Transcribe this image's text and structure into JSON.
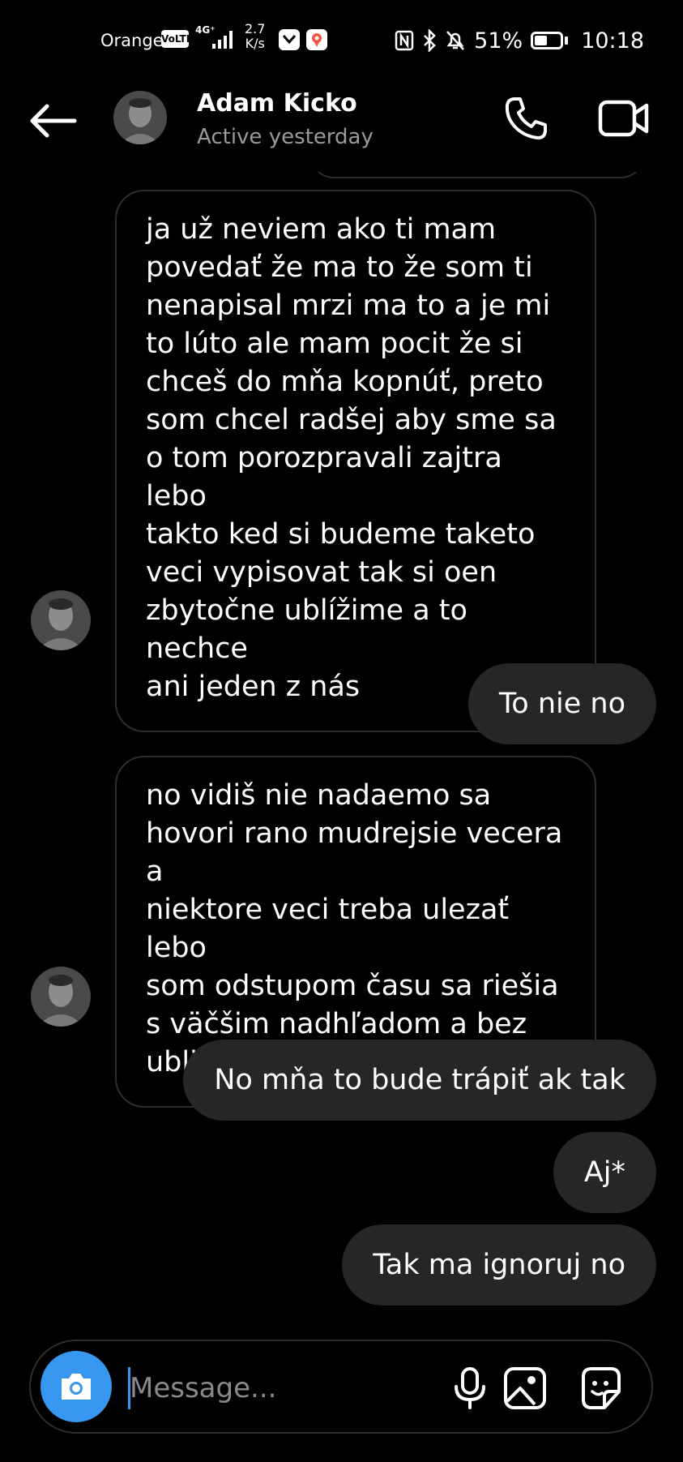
{
  "status_bar": {
    "carrier": "Orange",
    "volte": "VoLTE",
    "network": "4G⁺",
    "speed_value": "2.7",
    "speed_unit": "K/s",
    "battery": "51%",
    "time": "10:18"
  },
  "header": {
    "contact_name": "Adam Kicko",
    "contact_status": "Active yesterday"
  },
  "messages": [
    {
      "direction": "incoming",
      "text": "ja už neviem ako ti mam\npovedať že ma to že som ti\nnenapisal mrzi  ma to a je mi\nto lúto ale mam pocit že si\nchceš do mňa kopnúť, preto\nsom chcel radšej aby sme sa\no tom porozpravali zajtra lebo\ntakto ked si budeme taketo\nveci vypisovat tak si oen\nzbytočne ublížime a to nechce\nani jeden z nás"
    },
    {
      "direction": "outgoing",
      "text": "To nie no"
    },
    {
      "direction": "incoming",
      "text": "no vidiš nie nadaemo sa\nhovori rano mudrejsie vecera a\nniektore veci treba ulezať lebo\nsom odstupom času sa riešia\ns väčšim nadhľadom a bez\nubližovania"
    },
    {
      "direction": "outgoing",
      "text": "No mňa to bude trápiť ak tak"
    },
    {
      "direction": "outgoing",
      "text": "Aj*"
    },
    {
      "direction": "outgoing",
      "text": "Tak ma ignoruj no"
    }
  ],
  "composer": {
    "placeholder": "Message..."
  },
  "colors": {
    "background": "#000000",
    "outgoing_bubble": "#262626",
    "accent": "#3797f0",
    "secondary_text": "#9a9a9a"
  },
  "icons": [
    "back-arrow-icon",
    "phone-icon",
    "video-camera-icon",
    "camera-icon",
    "microphone-icon",
    "gallery-icon",
    "sticker-icon"
  ]
}
